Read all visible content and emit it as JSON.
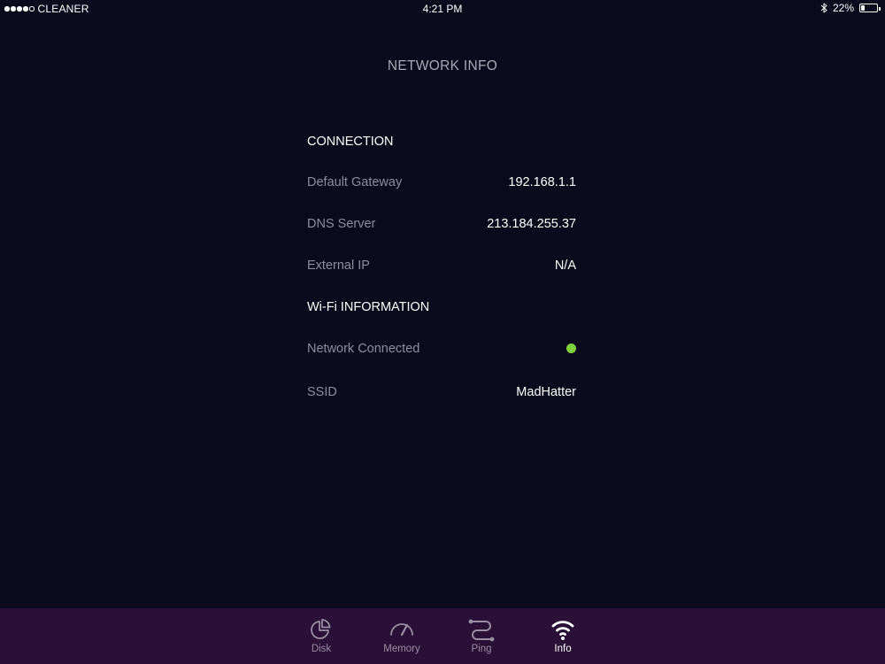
{
  "status_bar": {
    "carrier": "CLEANER",
    "time": "4:21 PM",
    "battery_percent": "22%",
    "battery_level": 0.22,
    "signal_bars_filled": 4,
    "signal_bars_total": 5,
    "bluetooth_icon": "bluetooth-icon"
  },
  "page": {
    "title": "NETWORK INFO"
  },
  "connection": {
    "header": "CONNECTION",
    "rows": [
      {
        "label": "Default Gateway",
        "value": "192.168.1.1"
      },
      {
        "label": "DNS Server",
        "value": "213.184.255.37"
      },
      {
        "label": "External IP",
        "value": "N/A"
      }
    ]
  },
  "wifi": {
    "header": "Wi-Fi INFORMATION",
    "network_connected_label": "Network Connected",
    "network_connected_status_color": "#7fd13b",
    "ssid_label": "SSID",
    "ssid_value": "MadHatter"
  },
  "tab_bar": {
    "background": "#2a0f36",
    "tabs": [
      {
        "label": "Disk",
        "icon": "disk-pie-icon",
        "active": false
      },
      {
        "label": "Memory",
        "icon": "gauge-icon",
        "active": false
      },
      {
        "label": "Ping",
        "icon": "ping-route-icon",
        "active": false
      },
      {
        "label": "Info",
        "icon": "wifi-icon",
        "active": true
      }
    ]
  }
}
